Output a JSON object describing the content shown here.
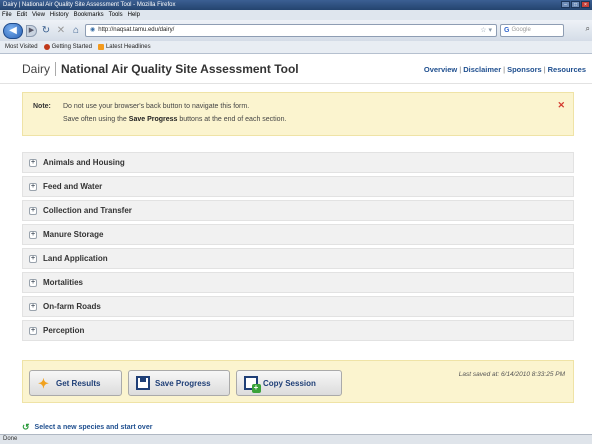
{
  "window": {
    "title": "Dairy | National Air Quality Site Assessment Tool - Mozilla Firefox"
  },
  "menu": [
    "File",
    "Edit",
    "View",
    "History",
    "Bookmarks",
    "Tools",
    "Help"
  ],
  "nav": {
    "url": "http://naqsat.tamu.edu/dairy/",
    "search_placeholder": "Google"
  },
  "bookmarks": [
    "Most Visited",
    "Getting Started",
    "Latest Headlines"
  ],
  "app": {
    "section": "Dairy",
    "title": "National Air Quality Site Assessment Tool"
  },
  "toplinks": [
    "Overview",
    "Disclaimer",
    "Sponsors",
    "Resources"
  ],
  "note": {
    "label": "Note:",
    "line1": "Do not use your browser's back button to navigate this form.",
    "line2_pre": "Save often using the ",
    "line2_bold": "Save Progress",
    "line2_post": " buttons at the end of each section."
  },
  "sections": [
    "Animals and Housing",
    "Feed and Water",
    "Collection and Transfer",
    "Manure Storage",
    "Land Application",
    "Mortalities",
    "On-farm Roads",
    "Perception"
  ],
  "actions": {
    "get_results": "Get Results",
    "save_progress": "Save Progress",
    "copy_session": "Copy Session",
    "last_saved": "Last saved at: 6/14/2010 8:33:25 PM"
  },
  "restart": "Select a new species and start over",
  "status": "Done"
}
